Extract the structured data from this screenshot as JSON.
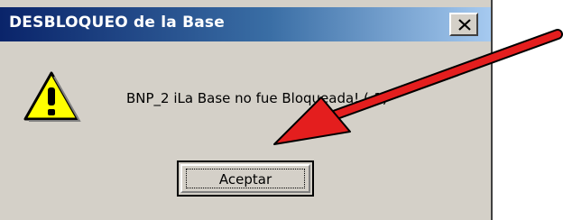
{
  "dialog": {
    "title": "DESBLOQUEO de la Base",
    "message": "BNP_2 iLa Base no fue Bloqueada! (-1)",
    "ok_label": "Aceptar",
    "close_icon": "close-icon",
    "warning_icon": "warning-icon"
  },
  "colors": {
    "titlebar_start": "#0a246a",
    "titlebar_end": "#a6caf0",
    "dialog_bg": "#d4d0c8",
    "arrow": "#e41e1e"
  }
}
